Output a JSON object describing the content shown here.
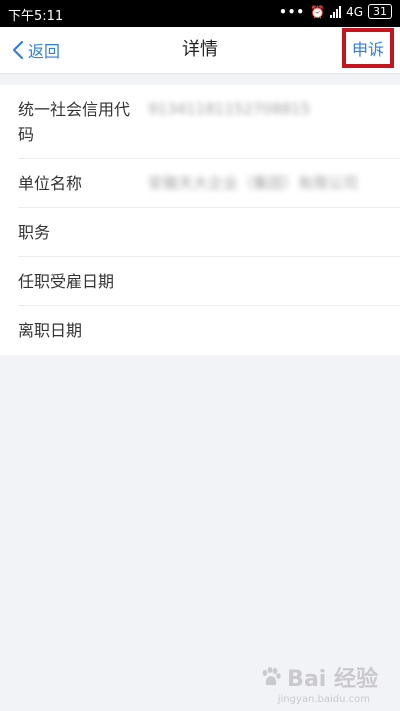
{
  "status_bar": {
    "time": "下午5:11",
    "network": "4G",
    "battery": "31"
  },
  "nav": {
    "back_label": "返回",
    "title": "详情",
    "complain_label": "申诉"
  },
  "details": [
    {
      "label": "统一社会信用代码",
      "value": "91341181152708815"
    },
    {
      "label": "单位名称",
      "value": "安徽天大企业（集团）有限公司"
    },
    {
      "label": "职务",
      "value": ""
    },
    {
      "label": "任职受雇日期",
      "value": ""
    },
    {
      "label": "离职日期",
      "value": ""
    }
  ],
  "watermark": {
    "text": "Bai 经验",
    "sub": "jingyan.baidu.com"
  },
  "colors": {
    "accent": "#2f7ee8",
    "highlight_border": "#c8141c",
    "background": "#f2f3f7"
  }
}
